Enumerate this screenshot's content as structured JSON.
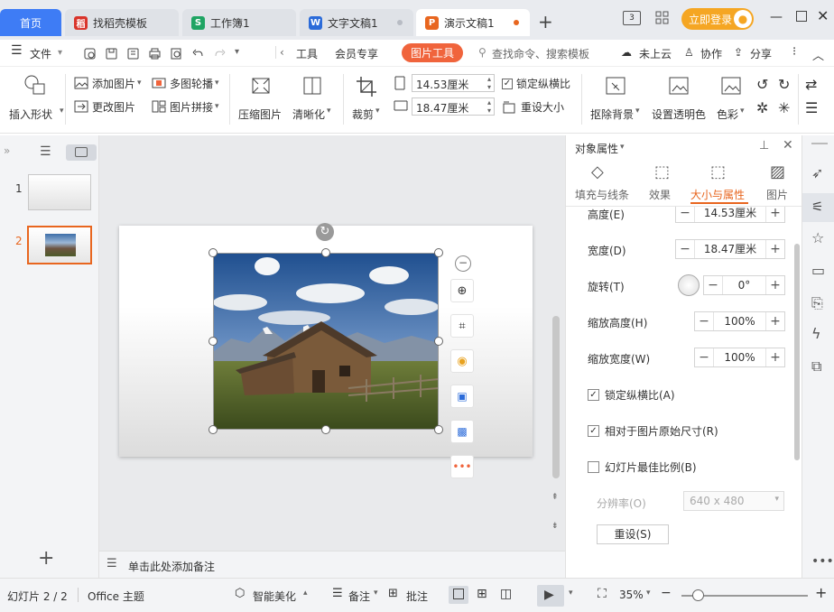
{
  "tabs": {
    "home": "首页",
    "items": [
      {
        "label": "找稻壳模板",
        "icon_color": "#d9342b",
        "icon_char": "稻"
      },
      {
        "label": "工作簿1",
        "icon_color": "#1fa463",
        "icon_char": "S"
      },
      {
        "label": "文字文稿1",
        "icon_color": "#2b6bd9",
        "icon_char": "W"
      },
      {
        "label": "演示文稿1",
        "icon_color": "#e8661f",
        "icon_char": "P"
      }
    ],
    "new_tab": "+",
    "login_label": "立即登录"
  },
  "menu": {
    "file": "文件",
    "tools": "工具",
    "vip": "会员专享",
    "picture_tools": "图片工具",
    "search_placeholder": "查找命令、搜索模板",
    "cloud": "未上云",
    "collab": "协作",
    "share": "分享"
  },
  "ribbon": {
    "insert_shape": "插入形状",
    "add_picture": "添加图片",
    "change_picture": "更改图片",
    "multi_outline": "多图轮播",
    "picture_collage": "图片拼接",
    "compress": "压缩图片",
    "clarity": "清晰化",
    "crop": "裁剪",
    "height_value": "14.53厘米",
    "width_value": "18.47厘米",
    "lock_ratio": "锁定纵横比",
    "reset_size": "重设大小",
    "remove_bg": "抠除背景",
    "set_transparent": "设置透明色",
    "color": "色彩"
  },
  "slides": [
    {
      "number": "1"
    },
    {
      "number": "2"
    }
  ],
  "notes_placeholder": "单击此处添加备注",
  "panel": {
    "title": "对象属性",
    "tabs": [
      "填充与线条",
      "效果",
      "大小与属性",
      "图片"
    ],
    "active_tab": "大小与属性",
    "height_label": "高度(E)",
    "height_value": "14.53厘米",
    "width_label": "宽度(D)",
    "width_value": "18.47厘米",
    "rotate_label": "旋转(T)",
    "rotate_value": "0°",
    "scale_h_label": "缩放高度(H)",
    "scale_h_value": "100%",
    "scale_w_label": "缩放宽度(W)",
    "scale_w_value": "100%",
    "lock_label": "锁定纵横比(A)",
    "relative_label": "相对于图片原始尺寸(R)",
    "best_label": "幻灯片最佳比例(B)",
    "resolution_label": "分辨率(O)",
    "resolution_value": "640 x 480",
    "reset_label": "重设(S)"
  },
  "status": {
    "slide_info": "幻灯片 2 / 2",
    "theme": "Office 主题",
    "beautify": "智能美化",
    "notes": "备注",
    "comments": "批注",
    "zoom": "35%"
  },
  "colors": {
    "accent": "#3e7cf5",
    "picture_tools": "#f0643c",
    "active_tab": "#e8661f",
    "login": "#f5a623"
  }
}
